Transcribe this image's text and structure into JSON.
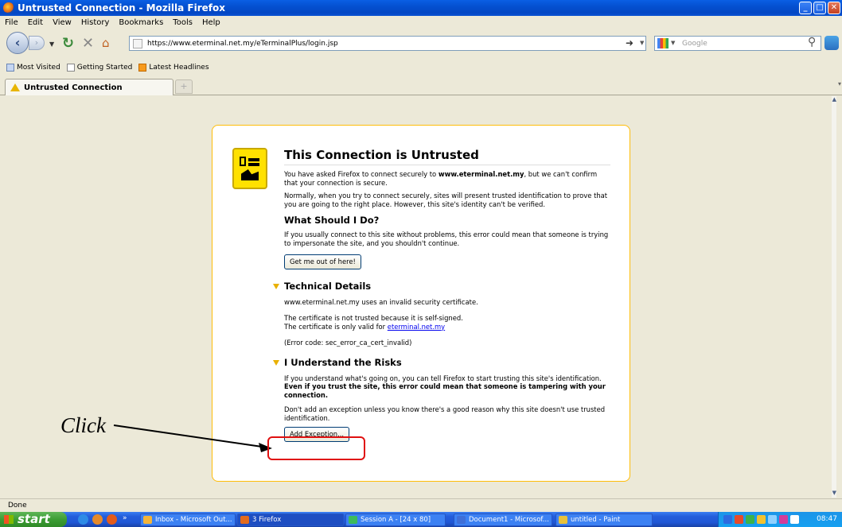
{
  "window": {
    "title": "Untrusted Connection - Mozilla Firefox"
  },
  "menu": [
    "File",
    "Edit",
    "View",
    "History",
    "Bookmarks",
    "Tools",
    "Help"
  ],
  "nav": {
    "url": "https://www.eterminal.net.my/eTerminalPlus/login.jsp",
    "search_placeholder": "Google"
  },
  "bookmarks": [
    "Most Visited",
    "Getting Started",
    "Latest Headlines"
  ],
  "tab": {
    "title": "Untrusted Connection",
    "new_tab": "+"
  },
  "error_page": {
    "title": "This Connection is Untrusted",
    "p1_before": "You have asked Firefox to connect securely to ",
    "p1_host": "www.eterminal.net.my",
    "p1_after": ", but we can't confirm that your connection is secure.",
    "p2": "Normally, when you try to connect securely, sites will present trusted identification to prove that you are going to the right place. However, this site's identity can't be verified.",
    "what_heading": "What Should I Do?",
    "what_text": "If you usually connect to this site without problems, this error could mean that someone is trying to impersonate the site, and you shouldn't continue.",
    "get_me_out": "Get me out of here!",
    "tech_heading": "Technical Details",
    "tech_line1": "www.eterminal.net.my uses an invalid security certificate.",
    "tech_line2": "The certificate is not trusted because it is self-signed.",
    "tech_line3_before": "The certificate is only valid for ",
    "tech_line3_link": "eterminal.net.my",
    "tech_error_code": "(Error code: sec_error_ca_cert_invalid)",
    "risks_heading": "I Understand the Risks",
    "risks_text_before": "If you understand what's going on, you can tell Firefox to start trusting this site's identification. ",
    "risks_text_bold": "Even if you trust the site, this error could mean that someone is tampering with your connection.",
    "risks_text2": "Don't add an exception unless you know there's a good reason why this site doesn't use trusted identification.",
    "add_exception": "Add Exception..."
  },
  "annotation": {
    "label": "Click",
    "color": "#e01010"
  },
  "status": "Done",
  "taskbar": {
    "start": "start",
    "tasks": [
      "Inbox - Microsoft Out...",
      "3 Firefox",
      "Session A - [24 x 80]",
      "Document1 - Microsof...",
      "untitled - Paint"
    ],
    "clock": "08:47"
  },
  "colors": {
    "titlebar": "#0450d0",
    "warning": "#ffbd09",
    "link": "#0000ee",
    "taskbar": "#245edb",
    "start": "#3c9d34"
  }
}
